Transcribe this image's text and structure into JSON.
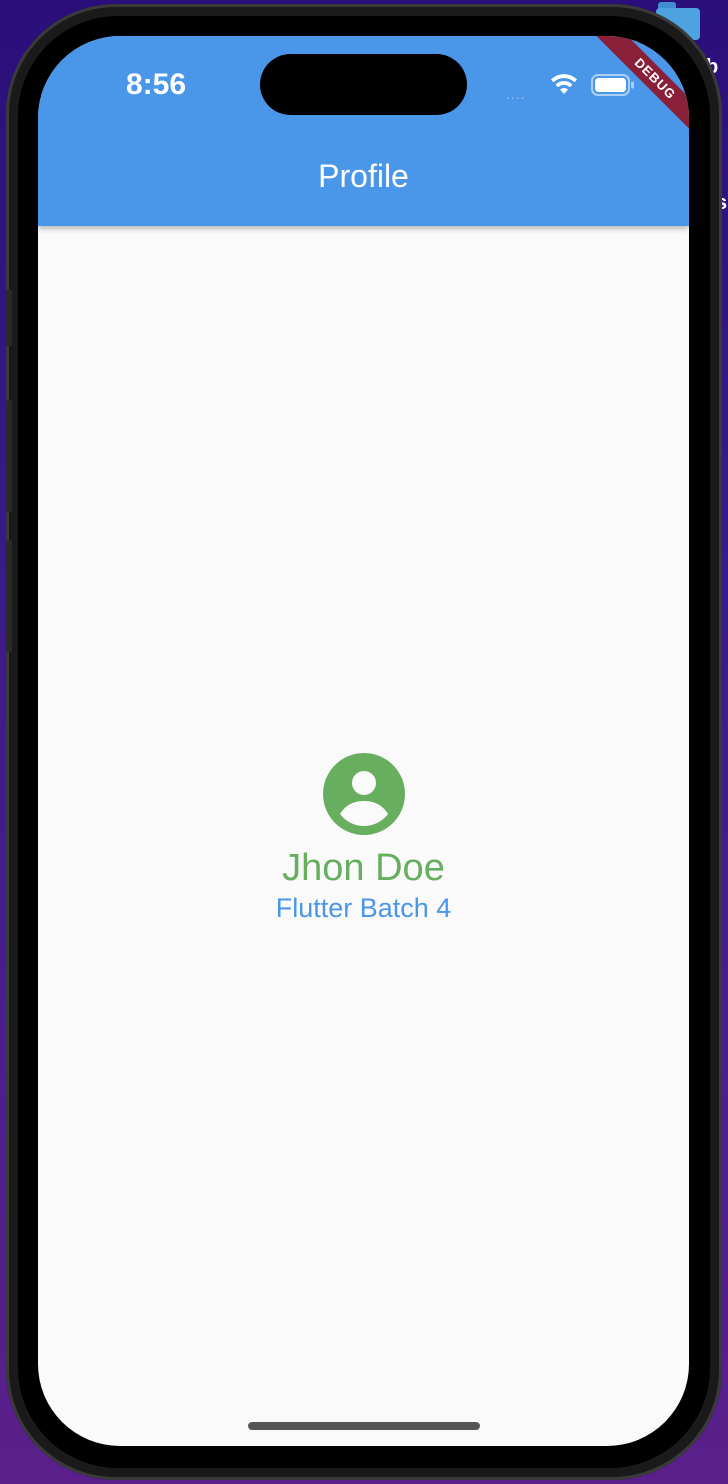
{
  "desktop": {
    "folder_icon": "folder-icon",
    "label_fragment_1": "b",
    "label_fragment_2": "s"
  },
  "status_bar": {
    "time": "8:56",
    "signal": "....",
    "wifi_icon": "wifi-icon",
    "battery_icon": "battery-icon"
  },
  "app_bar": {
    "title": "Profile",
    "debug_banner": "DEBUG"
  },
  "profile": {
    "avatar_icon": "account-circle-icon",
    "name": "Jhon Doe",
    "batch": "Flutter Batch 4"
  },
  "colors": {
    "app_bar": "#4a96e8",
    "name_green": "#67ae5f",
    "batch_blue": "#4a96e8",
    "debug_banner": "#8a1f3a",
    "screen_background": "#fafafa"
  }
}
